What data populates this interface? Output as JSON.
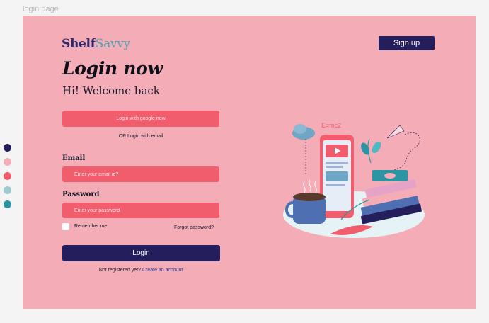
{
  "frame": {
    "label": "login page"
  },
  "swatches": [
    "#241f5c",
    "#f4acb7",
    "#f25d6d",
    "#9ec9d1",
    "#2b95a3"
  ],
  "brand": {
    "part1": "Shelf",
    "part2": "Savvy"
  },
  "header": {
    "signup_label": "Sign up"
  },
  "main": {
    "title": "Login now",
    "subtitle": "Hi! Welcome back",
    "google_button": "Login with google now",
    "or_text": "OR Login with email",
    "email_label": "Email",
    "email_placeholder": "Enter your email id?",
    "password_label": "Password",
    "password_placeholder": "Enter your password",
    "remember_label": "Remember me",
    "forgot_label": "Forgot password?",
    "login_button": "Login",
    "not_registered_text": "Not registered yet?",
    "create_account_link": "Create an account"
  },
  "illustration": {
    "formula": "E=mc2"
  }
}
